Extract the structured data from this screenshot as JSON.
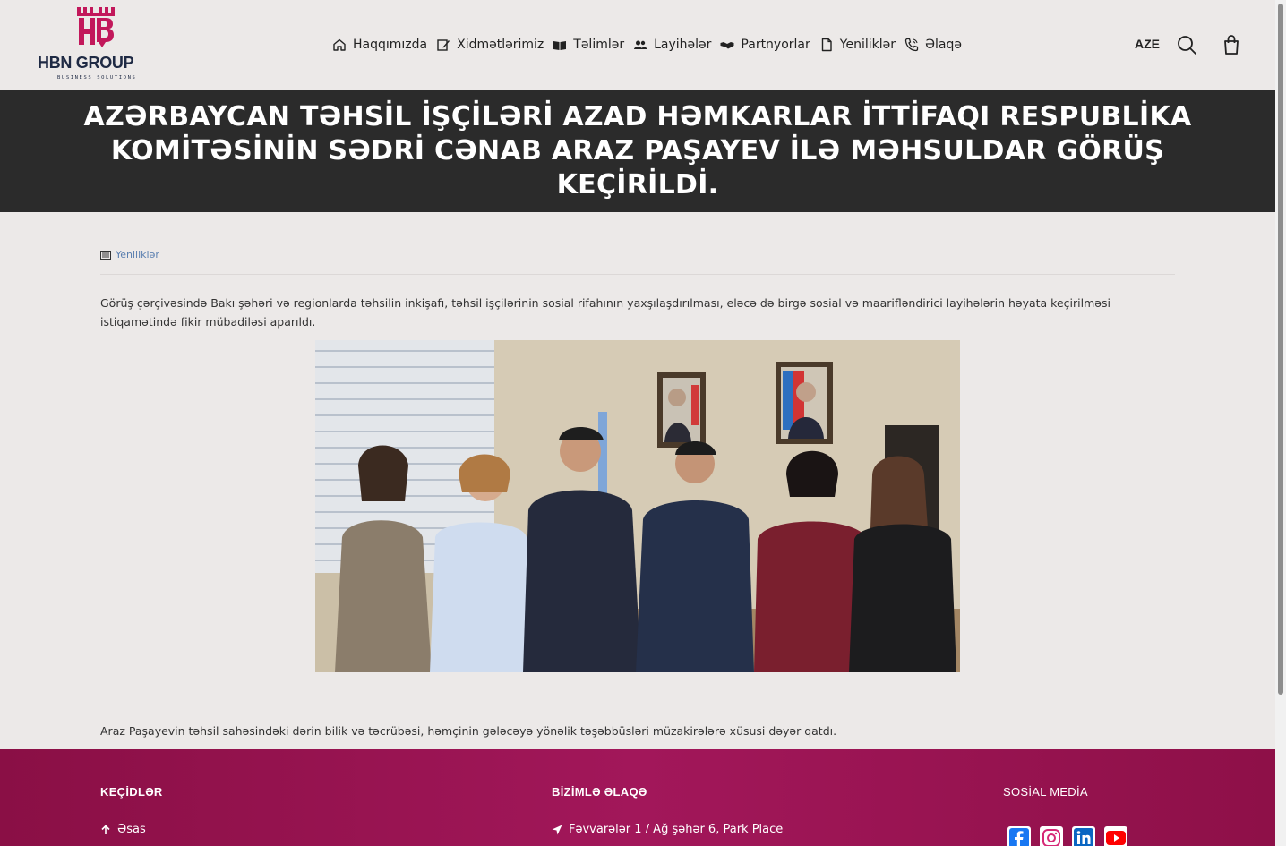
{
  "brand": {
    "name": "HBN GROUP",
    "tagline": "BUSINESS SOLUTIONS",
    "color": "#c2185b"
  },
  "nav": {
    "items": [
      {
        "label": "Haqqımızda",
        "icon": "home-icon"
      },
      {
        "label": "Xidmətlərimiz",
        "icon": "edit-icon"
      },
      {
        "label": "Təlimlər",
        "icon": "book-icon"
      },
      {
        "label": "Layihələr",
        "icon": "users-icon"
      },
      {
        "label": "Partnyorlar",
        "icon": "handshake-icon"
      },
      {
        "label": "Yeniliklər",
        "icon": "document-icon"
      },
      {
        "label": "Əlaqə",
        "icon": "phone-icon"
      }
    ],
    "language": "AZE"
  },
  "page": {
    "title": "AZƏRBAYCAN TƏHSİL İŞÇİLƏRİ AZAD HƏMKARLAR İTTİFAQI RESPUBLİKA KOMİTƏSİNİN SƏDRİ CƏNAB ARAZ PAŞAYEV İLƏ MƏHSULDAR GÖRÜŞ KEÇİRİLDİ.",
    "breadcrumb": "Yeniliklər",
    "paragraph1": "Görüş çərçivəsində Bakı şəhəri və regionlarda təhsilin inkişafı, təhsil işçilərinin sosial rifahının yaxşılaşdırılması, eləcə də birgə sosial və maarifləndirici layihələrin həyata keçirilməsi istiqamətində fikir mübadiləsi aparıldı.",
    "paragraph2": "Araz Paşayevin təhsil sahəsindəki dərin bilik və təcrübəsi, həmçinin gələcəyə yönəlik təşəbbüsləri müzakirələrə xüsusi dəyər qatdı."
  },
  "footer": {
    "links_heading": "KEÇİDLƏR",
    "links": [
      "Əsas"
    ],
    "contact_heading": "BİZİMLƏ ƏLAQƏ",
    "address": "Fəvvarələr 1 / Ağ şəhər 6, Park Place",
    "social_heading": "SOSİAL MEDİA",
    "social": [
      {
        "icon": "facebook-icon",
        "color": "#1877f2"
      },
      {
        "icon": "instagram-icon",
        "color": "#d62976"
      },
      {
        "icon": "linkedin-icon",
        "color": "#0a66c2"
      },
      {
        "icon": "youtube-icon",
        "color": "#ff0000"
      }
    ]
  }
}
